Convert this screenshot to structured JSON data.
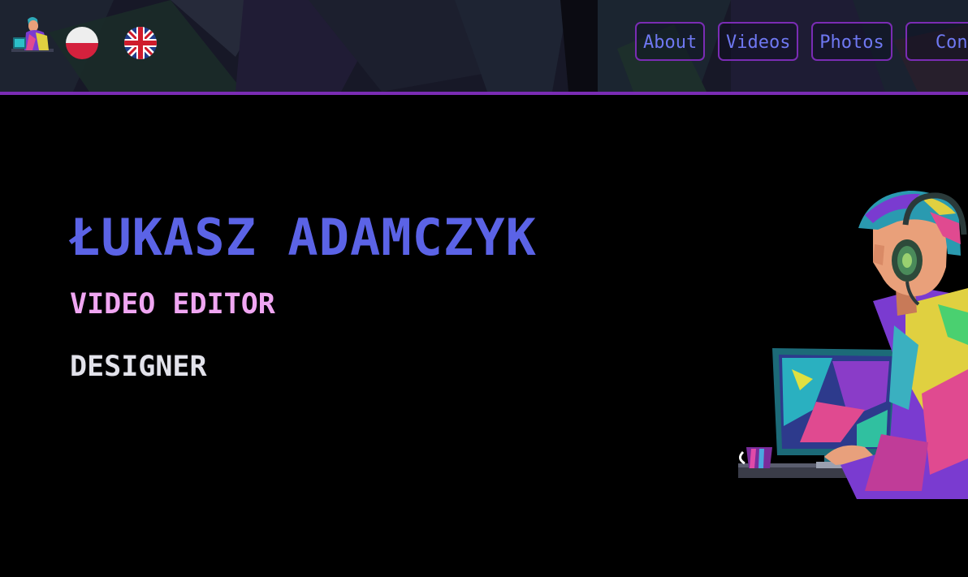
{
  "header": {
    "logo_icon": "editor-avatar-logo-icon",
    "languages": [
      {
        "code": "pl",
        "icon": "poland-flag-icon"
      },
      {
        "code": "en",
        "icon": "uk-flag-icon"
      }
    ],
    "nav": [
      {
        "label": "About"
      },
      {
        "label": "Videos"
      },
      {
        "label": "Photos"
      },
      {
        "label": "Conta"
      }
    ]
  },
  "hero": {
    "name": "ŁUKASZ ADAMCZYK",
    "role": "VIDEO EDITOR",
    "role2": "DESIGNER",
    "illustration": "video-editor-at-computer-illustration"
  },
  "colors": {
    "background": "#000000",
    "header_border": "#7a2cb4",
    "nav_text": "#6f78f2",
    "name": "#5b63e6",
    "role": "#f0a6f2",
    "role2": "#e2e2ea"
  }
}
